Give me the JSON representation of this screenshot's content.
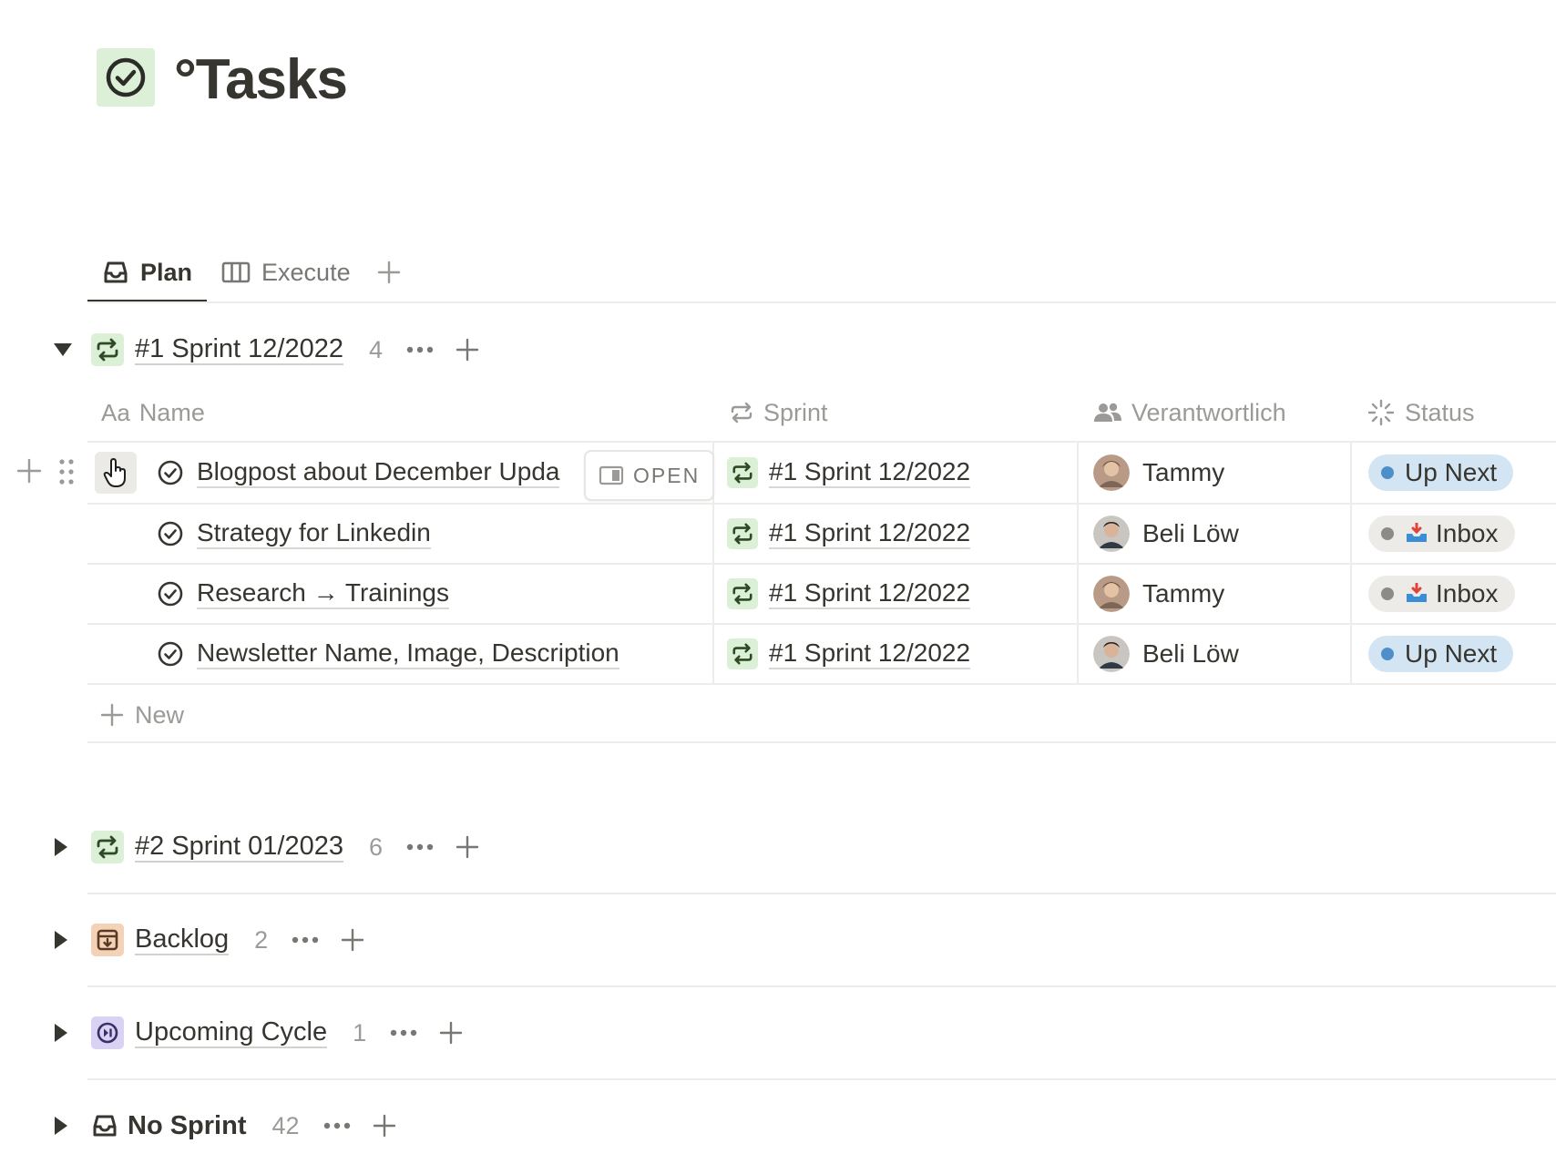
{
  "page": {
    "title": "°Tasks",
    "icon": "check-circle-icon"
  },
  "tabs": [
    {
      "label": "Plan",
      "icon": "inbox-tray-icon",
      "active": true
    },
    {
      "label": "Execute",
      "icon": "board-columns-icon",
      "active": false
    }
  ],
  "columns": {
    "name": "Name",
    "name_prefix": "Aa",
    "sprint": "Sprint",
    "owner": "Verantwortlich",
    "status": "Status"
  },
  "group1": {
    "title": "#1 Sprint 12/2022",
    "count": "4",
    "open_label": "OPEN",
    "new_label": "New",
    "rows": [
      {
        "name": "Blogpost about December Upda",
        "sprint": "#1 Sprint 12/2022",
        "owner": "Tammy",
        "status": "Up Next"
      },
      {
        "name": "Strategy for Linkedin",
        "sprint": "#1 Sprint 12/2022",
        "owner": "Beli Löw",
        "status": "Inbox"
      },
      {
        "name": "Research → Trainings",
        "sprint": "#1 Sprint 12/2022",
        "owner": "Tammy",
        "status": "Inbox"
      },
      {
        "name": "Newsletter Name, Image, Description",
        "sprint": "#1 Sprint 12/2022",
        "owner": "Beli Löw",
        "status": "Up Next"
      }
    ]
  },
  "groups": [
    {
      "title": "#2 Sprint 01/2023",
      "count": "6",
      "icon": "repeat-icon",
      "color": "#dcefd7"
    },
    {
      "title": "Backlog",
      "count": "2",
      "icon": "archive-box-icon",
      "color": "#f3d2b8"
    },
    {
      "title": "Upcoming Cycle",
      "count": "1",
      "icon": "skip-forward-circle-icon",
      "color": "#d9d2f3"
    },
    {
      "title": "No Sprint",
      "count": "42",
      "icon": "inbox-tray-icon",
      "color": "#ffffff"
    }
  ],
  "colors": {
    "sprint_green": "#dcefd7",
    "up_next_bg": "#d3e5f3",
    "up_next_dot": "#4f8fc9",
    "inbox_bg": "#ecebe8",
    "inbox_dot": "#8c8b88"
  }
}
